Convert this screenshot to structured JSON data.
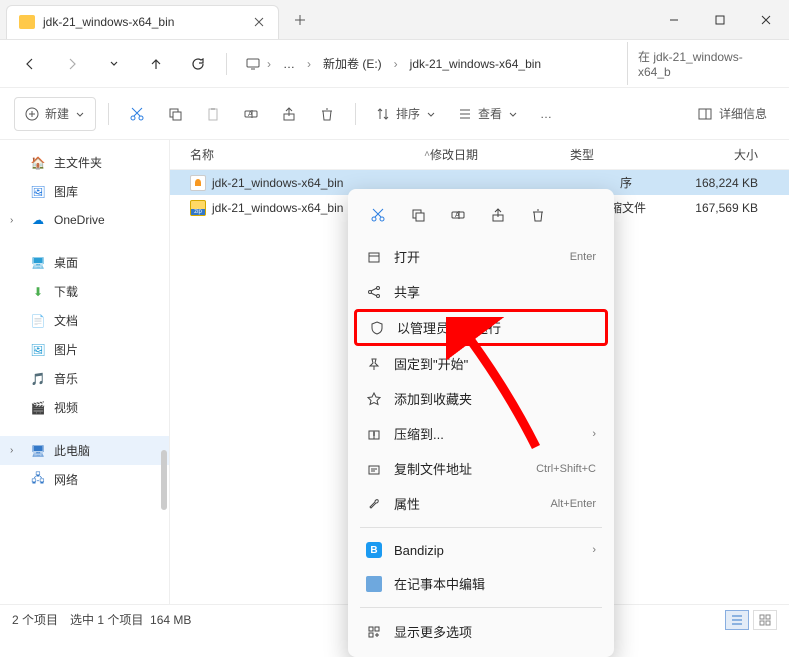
{
  "window": {
    "tab_title": "jdk-21_windows-x64_bin"
  },
  "nav": {
    "breadcrumb": [
      "新加卷 (E:)",
      "jdk-21_windows-x64_bin"
    ],
    "search_placeholder": "在 jdk-21_windows-x64_b"
  },
  "toolbar": {
    "new_label": "新建",
    "sort_label": "排序",
    "view_label": "查看",
    "details_label": "详细信息"
  },
  "sidebar": {
    "items": [
      {
        "label": "主文件夹",
        "icon": "home"
      },
      {
        "label": "图库",
        "icon": "gallery"
      },
      {
        "label": "OneDrive",
        "icon": "onedrive",
        "expandable": true
      },
      {
        "spacer": true
      },
      {
        "label": "桌面",
        "icon": "desktop"
      },
      {
        "label": "下载",
        "icon": "download"
      },
      {
        "label": "文档",
        "icon": "document"
      },
      {
        "label": "图片",
        "icon": "picture"
      },
      {
        "label": "音乐",
        "icon": "music"
      },
      {
        "label": "视频",
        "icon": "video"
      },
      {
        "spacer": true
      },
      {
        "label": "此电脑",
        "icon": "pc",
        "selected": true,
        "expandable": true
      },
      {
        "label": "网络",
        "icon": "network"
      }
    ]
  },
  "columns": {
    "name": "名称",
    "date": "修改日期",
    "type": "类型",
    "size": "大小"
  },
  "files": [
    {
      "name": "jdk-21_windows-x64_bin",
      "type_partial": "序",
      "size": "168,224 KB",
      "icon": "java",
      "selected": true
    },
    {
      "name": "jdk-21_windows-x64_bin",
      "type_partial": "缩文件",
      "size": "167,569 KB",
      "icon": "zip"
    }
  ],
  "context_menu": {
    "items": [
      {
        "label": "打开",
        "icon": "open",
        "shortcut": "Enter"
      },
      {
        "label": "共享",
        "icon": "share"
      },
      {
        "label": "以管理员身份运行",
        "icon": "admin",
        "highlight": true
      },
      {
        "label": "固定到\"开始\"",
        "icon": "pin"
      },
      {
        "label": "添加到收藏夹",
        "icon": "star"
      },
      {
        "label": "压缩到...",
        "icon": "compress",
        "submenu": true
      },
      {
        "label": "复制文件地址",
        "icon": "copy-path",
        "shortcut": "Ctrl+Shift+C"
      },
      {
        "label": "属性",
        "icon": "properties",
        "shortcut": "Alt+Enter"
      },
      {
        "divider": true
      },
      {
        "label": "Bandizip",
        "icon": "bandizip",
        "submenu": true
      },
      {
        "label": "在记事本中编辑",
        "icon": "notepad"
      },
      {
        "divider": true
      },
      {
        "label": "显示更多选项",
        "icon": "more"
      }
    ]
  },
  "status": {
    "count": "2 个项目",
    "selected": "选中 1 个项目",
    "size": "164 MB"
  }
}
